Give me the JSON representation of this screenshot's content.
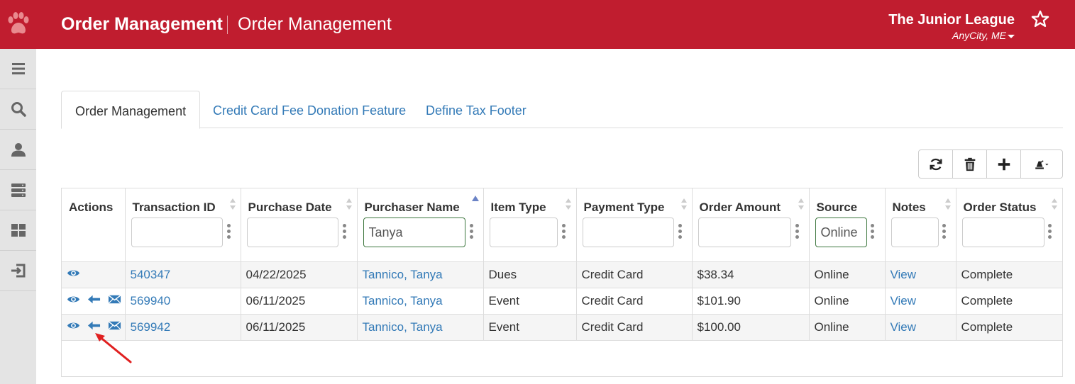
{
  "header": {
    "app_title": "Order Management",
    "page_title": "Order Management",
    "org_name": "The Junior League",
    "org_city": "AnyCity, ME"
  },
  "sidebar": {
    "items": [
      {
        "icon": "menu-icon"
      },
      {
        "icon": "search-icon"
      },
      {
        "icon": "user-icon"
      },
      {
        "icon": "server-icon"
      },
      {
        "icon": "dashboard-grid-icon"
      },
      {
        "icon": "logout-icon"
      }
    ]
  },
  "tabs": [
    {
      "label": "Order Management",
      "active": true
    },
    {
      "label": "Credit Card Fee Donation Feature",
      "active": false
    },
    {
      "label": "Define Tax Footer",
      "active": false
    }
  ],
  "toolbar": {
    "buttons": [
      "refresh-icon",
      "trash-icon",
      "plus-icon",
      "export-icon"
    ]
  },
  "grid": {
    "columns": [
      {
        "label": "Actions"
      },
      {
        "label": "Transaction ID",
        "filter": ""
      },
      {
        "label": "Purchase Date",
        "filter": ""
      },
      {
        "label": "Purchaser Name",
        "filter": "Tanya",
        "sorted": "asc"
      },
      {
        "label": "Item Type",
        "filter": ""
      },
      {
        "label": "Payment Type",
        "filter": ""
      },
      {
        "label": "Order Amount",
        "filter": ""
      },
      {
        "label": "Source",
        "filter": "Online"
      },
      {
        "label": "Notes",
        "filter": ""
      },
      {
        "label": "Order Status",
        "filter": ""
      }
    ],
    "rows": [
      {
        "transaction_id": "540347",
        "purchase_date": "04/22/2025",
        "purchaser": "Tannico, Tanya",
        "item_type": "Dues",
        "payment_type": "Credit Card",
        "amount": "$38.34",
        "source": "Online",
        "notes": "View",
        "status": "Complete",
        "actions": [
          "view-icon"
        ]
      },
      {
        "transaction_id": "569940",
        "purchase_date": "06/11/2025",
        "purchaser": "Tannico, Tanya",
        "item_type": "Event",
        "payment_type": "Credit Card",
        "amount": "$101.90",
        "source": "Online",
        "notes": "View",
        "status": "Complete",
        "actions": [
          "view-icon",
          "refund-arrow-icon",
          "email-icon"
        ]
      },
      {
        "transaction_id": "569942",
        "purchase_date": "06/11/2025",
        "purchaser": "Tannico, Tanya",
        "item_type": "Event",
        "payment_type": "Credit Card",
        "amount": "$100.00",
        "source": "Online",
        "notes": "View",
        "status": "Complete",
        "actions": [
          "view-icon",
          "refund-arrow-icon",
          "email-icon"
        ]
      }
    ]
  },
  "colors": {
    "brand": "#c01d2f",
    "link": "#337ab7",
    "annotation": "#e02020"
  }
}
